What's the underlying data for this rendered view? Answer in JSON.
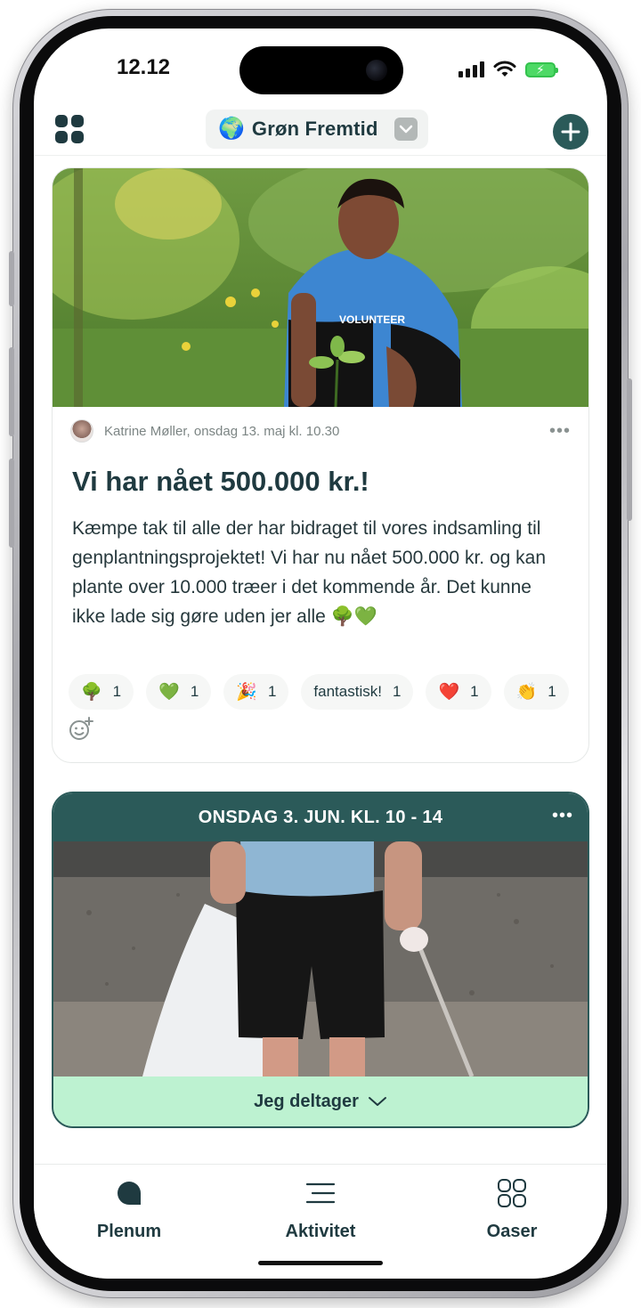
{
  "status": {
    "time": "12.12"
  },
  "header": {
    "community_emoji": "🌍",
    "community_name": "Grøn Fremtid"
  },
  "post": {
    "author_meta": "Katrine Møller, onsdag 13. maj kl. 10.30",
    "title": "Vi har nået 500.000 kr.!",
    "body": "Kæmpe tak til alle der har bidraget til vores indsamling til genplantningsprojektet! Vi har nu nået 500.000 kr. og kan plante over 10.000 træer i det kommende år. Det kunne ikke lade sig gøre uden jer alle 🌳💚",
    "photo_text": "VOLUNTEER",
    "reactions": [
      {
        "emoji": "🌳",
        "count": "1"
      },
      {
        "emoji": "💚",
        "count": "1"
      },
      {
        "emoji": "🎉",
        "count": "1"
      },
      {
        "text": "fantastisk!",
        "count": "1"
      },
      {
        "emoji": "❤️",
        "count": "1"
      },
      {
        "emoji": "👏",
        "count": "1"
      }
    ]
  },
  "event": {
    "date": "ONSDAG 3. JUN. KL. 10 - 14",
    "join_label": "Jeg deltager"
  },
  "nav": {
    "plenum": "Plenum",
    "aktivitet": "Aktivitet",
    "oaser": "Oaser"
  },
  "colors": {
    "brand_dark": "#2b5a59",
    "text_dark": "#1f3a40",
    "join_green": "#bdf2d1"
  }
}
